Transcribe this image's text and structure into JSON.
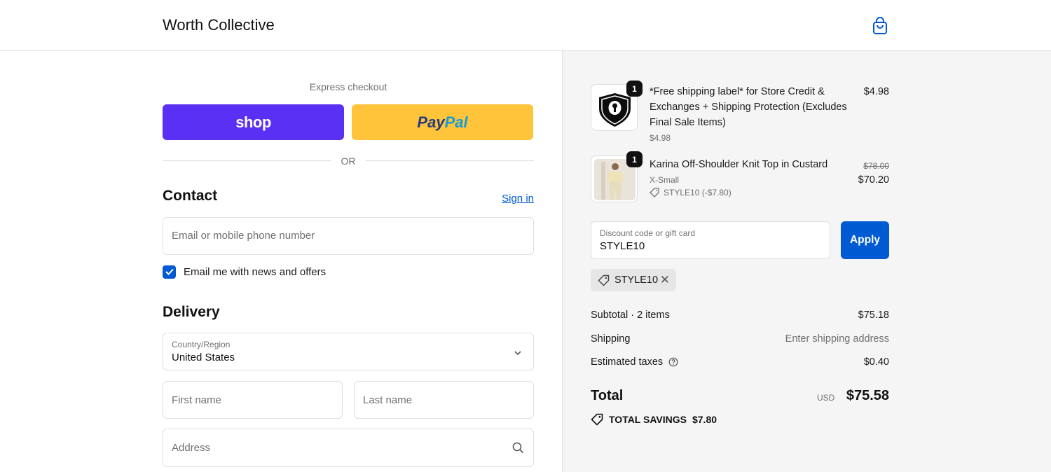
{
  "header": {
    "brand": "Worth Collective",
    "cart_icon": "shopping-bag-icon"
  },
  "express": {
    "label": "Express checkout",
    "shop_label": "shop",
    "paypal_part1": "Pay",
    "paypal_part2": "Pal",
    "or": "OR"
  },
  "contact": {
    "title": "Contact",
    "sign_in": "Sign in",
    "email_placeholder": "Email or mobile phone number",
    "newsletter_label": "Email me with news and offers",
    "newsletter_checked": true
  },
  "delivery": {
    "title": "Delivery",
    "country_label": "Country/Region",
    "country_value": "United States",
    "first_name_placeholder": "First name",
    "last_name_placeholder": "Last name",
    "address_placeholder": "Address"
  },
  "order": {
    "items": [
      {
        "qty": "1",
        "title_line1": "*Free shipping label* for Store Credit &",
        "title_line2": "Exchanges + Shipping Protection (Excludes",
        "title_line3": "Final Sale Items)",
        "unit_price": "$4.98",
        "price": "$4.98",
        "icon": "shield-lock-icon"
      },
      {
        "qty": "1",
        "title": "Karina Off-Shoulder Knit Top in Custard",
        "variant": "X-Small",
        "discount": "STYLE10 (-$7.80)",
        "original_price": "$78.00",
        "price": "$70.20"
      }
    ],
    "discount_field_label": "Discount code or gift card",
    "discount_field_value": "STYLE10",
    "apply_label": "Apply",
    "applied_code": "STYLE10",
    "subtotal_label": "Subtotal · 2 items",
    "subtotal_value": "$75.18",
    "shipping_label": "Shipping",
    "shipping_value": "Enter shipping address",
    "taxes_label": "Estimated taxes",
    "taxes_value": "$0.40",
    "total_label": "Total",
    "total_currency": "USD",
    "total_value": "$75.58",
    "savings_label": "TOTAL SAVINGS",
    "savings_value": "$7.80"
  },
  "colors": {
    "accent": "#005bd3",
    "shop_purple": "#5a31f4",
    "paypal_yellow": "#ffc439"
  }
}
